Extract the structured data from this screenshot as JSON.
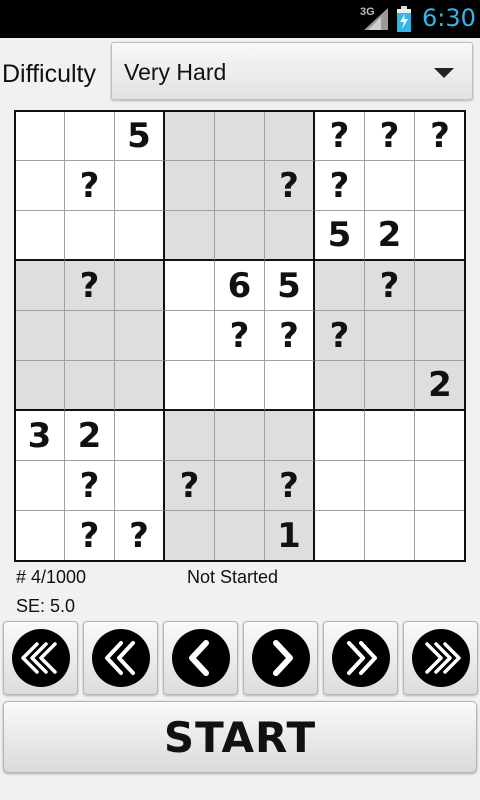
{
  "status_bar": {
    "network": "3G",
    "time": "6:30",
    "icons": [
      "signal-icon",
      "battery-charging-icon"
    ]
  },
  "difficulty": {
    "label": "Difficulty",
    "selected": "Very Hard"
  },
  "board": {
    "grid": [
      [
        "",
        "",
        "5",
        "",
        "",
        "",
        "?",
        "?",
        "?"
      ],
      [
        "",
        "?",
        "",
        "",
        "",
        "?",
        "?",
        "",
        ""
      ],
      [
        "",
        "",
        "",
        "",
        "",
        "",
        "5",
        "2",
        ""
      ],
      [
        "",
        "?",
        "",
        "",
        "6",
        "5",
        "",
        "?",
        ""
      ],
      [
        "",
        "",
        "",
        "",
        "?",
        "?",
        "?",
        "",
        ""
      ],
      [
        "",
        "",
        "",
        "",
        "",
        "",
        "",
        "",
        "2"
      ],
      [
        "3",
        "2",
        "",
        "",
        "",
        "",
        "",
        "",
        ""
      ],
      [
        "",
        "?",
        "",
        "?",
        "",
        "?",
        "",
        "",
        ""
      ],
      [
        "",
        "?",
        "?",
        "",
        "",
        "1",
        "",
        "",
        ""
      ]
    ],
    "shaded_boxes": [
      [
        0,
        1
      ],
      [
        1,
        0
      ],
      [
        1,
        2
      ],
      [
        2,
        1
      ]
    ],
    "shade_color": "#dedede"
  },
  "info": {
    "puzzle_number": "# 4/1000",
    "status": "Not Started",
    "se_rating": "SE: 5.0"
  },
  "navigation": {
    "buttons": [
      {
        "name": "first-puzzle-button",
        "icon": "triple-chevron-left-icon"
      },
      {
        "name": "back-ten-button",
        "icon": "double-chevron-left-icon"
      },
      {
        "name": "previous-button",
        "icon": "chevron-left-icon"
      },
      {
        "name": "next-button",
        "icon": "chevron-right-icon"
      },
      {
        "name": "forward-ten-button",
        "icon": "double-chevron-right-icon"
      },
      {
        "name": "last-puzzle-button",
        "icon": "triple-chevron-right-icon"
      }
    ]
  },
  "start_button": {
    "label": "START"
  }
}
